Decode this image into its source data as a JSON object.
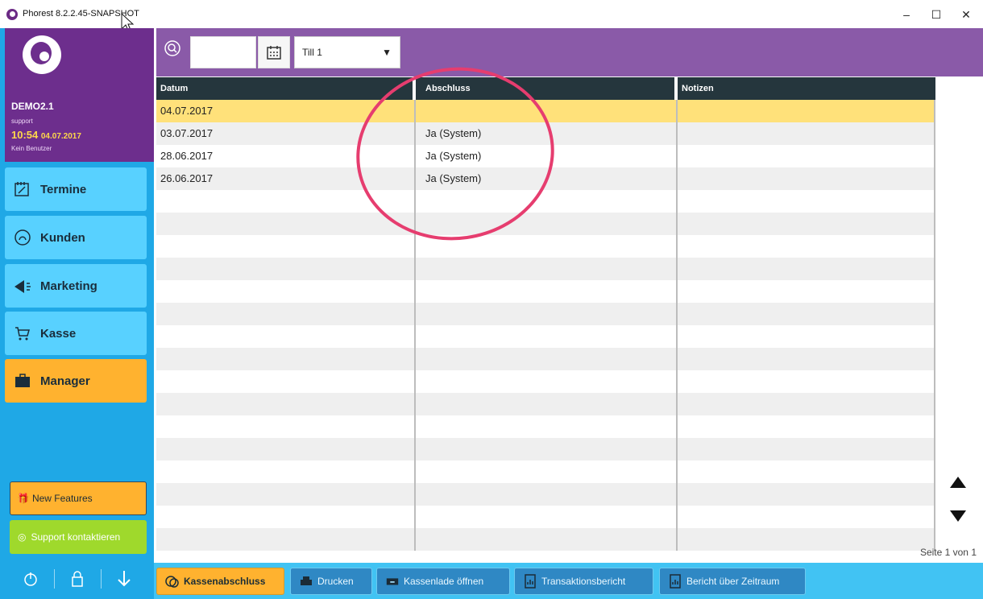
{
  "window": {
    "title": "Phorest 8.2.2.45-SNAPSHOT",
    "min_glyph": "–",
    "max_glyph": "☐",
    "close_glyph": "✕"
  },
  "sidebar": {
    "account": "DEMO2.1",
    "user": "support",
    "time": "10:54",
    "date": "04.07.2017",
    "status": "Kein Benutzer",
    "nav": [
      {
        "label": "Termine",
        "icon": "calendar-edit-icon"
      },
      {
        "label": "Kunden",
        "icon": "person-icon"
      },
      {
        "label": "Marketing",
        "icon": "megaphone-icon"
      },
      {
        "label": "Kasse",
        "icon": "cart-icon"
      },
      {
        "label": "Manager",
        "icon": "briefcase-icon"
      }
    ],
    "new_features": "New Features",
    "support": "Support kontaktieren"
  },
  "toolbar": {
    "date_value": "",
    "till_selected": "Till 1"
  },
  "table": {
    "columns": [
      "Datum",
      "Abschluss",
      "Notizen"
    ],
    "rows": [
      {
        "datum": "04.07.2017",
        "abschluss": "",
        "notizen": ""
      },
      {
        "datum": "03.07.2017",
        "abschluss": "Ja (System)",
        "notizen": ""
      },
      {
        "datum": "28.06.2017",
        "abschluss": "Ja (System)",
        "notizen": ""
      },
      {
        "datum": "26.06.2017",
        "abschluss": "Ja (System)",
        "notizen": ""
      }
    ],
    "pager": "Seite 1 von 1"
  },
  "bottom": {
    "buttons": [
      "Kassenabschluss",
      "Drucken",
      "Kassenlade öffnen",
      "Transaktionsbericht",
      "Bericht über Zeitraum"
    ]
  },
  "colors": {
    "purple": "#6d2e8d",
    "blue": "#1fa8e6",
    "orange": "#ffb22f",
    "highlight": "#e63d6f"
  }
}
